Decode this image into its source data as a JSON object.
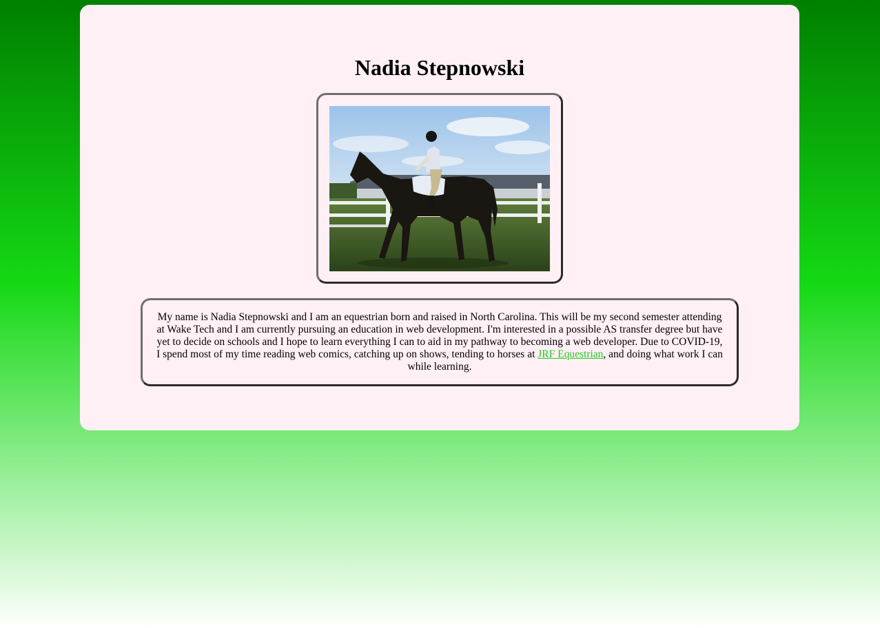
{
  "profile": {
    "name": "Nadia Stepnowski",
    "photo_alt": "Rider on a dark horse in a grassy paddock",
    "bio_before_link": "My name is Nadia Stepnowski and I am an equestrian born and raised in North Carolina. This will be my second semester attending at Wake Tech and I am currently pursuing an education in web development. I'm interested in a possible AS transfer degree but have yet to decide on schools and I hope to learn everything I can to aid in my pathway to becoming a web developer. Due to COVID-19, I spend most of my time reading web comics, catching up on shows, tending to horses at ",
    "link_text": "JRF Equestrian",
    "bio_after_link": ", and doing what work I can while learning."
  },
  "colors": {
    "background_top": "#008000",
    "background_mid": "#14d814",
    "background_bottom": "#ffffff",
    "card": "#fff0f5",
    "link": "#22cc22",
    "border_dark": "#2a2a2a",
    "border_light": "#6e6e6e"
  }
}
